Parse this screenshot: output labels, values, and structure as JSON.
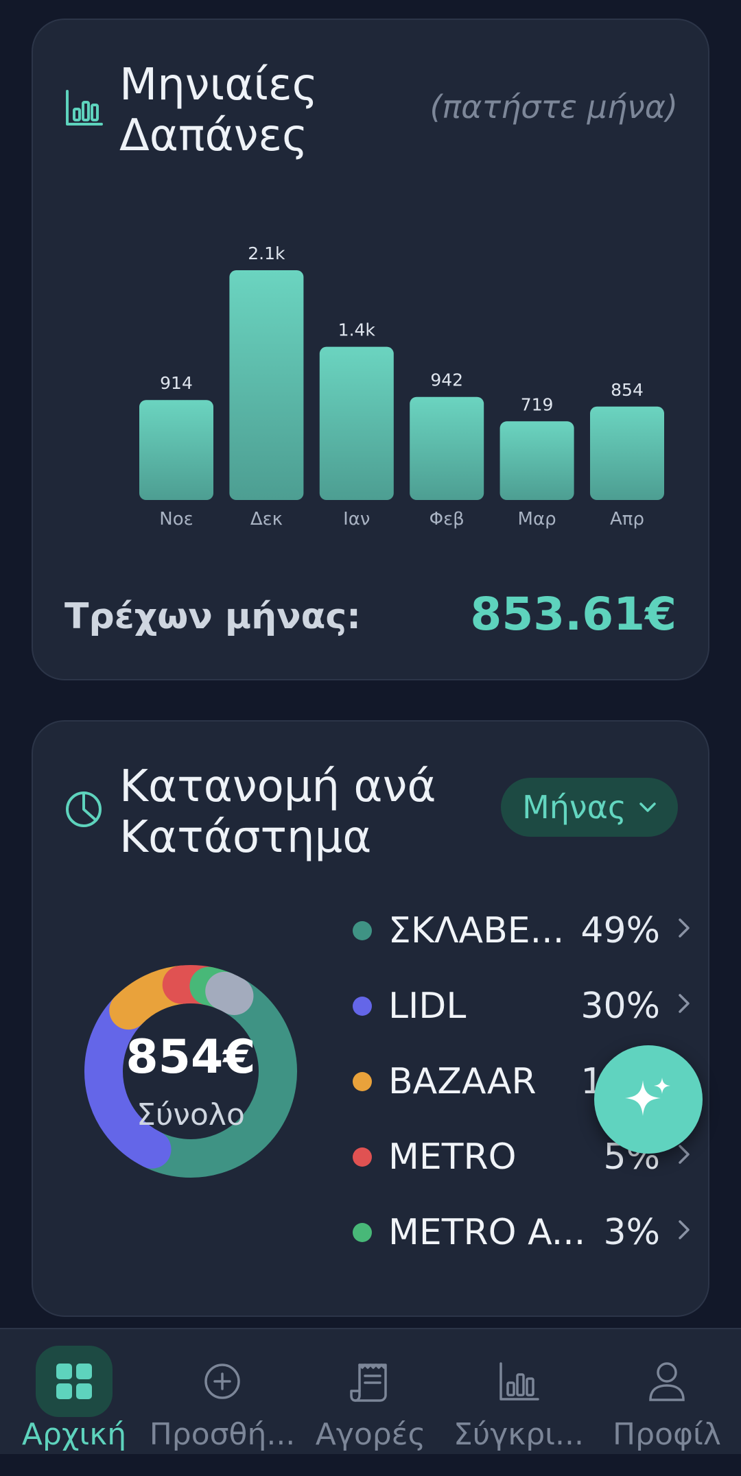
{
  "monthly": {
    "title_line1": "Μηνιαίες",
    "title_line2": "Δαπάνες",
    "hint": "(πατήστε μήνα)",
    "current_label": "Τρέχων μήνας:",
    "current_value": "853.61€"
  },
  "chart_data": {
    "type": "bar",
    "categories": [
      "Νοε",
      "Δεκ",
      "Ιαν",
      "Φεβ",
      "Μαρ",
      "Απρ"
    ],
    "values": [
      914,
      2100,
      1400,
      942,
      719,
      854
    ],
    "value_labels": [
      "914",
      "2.1k",
      "1.4k",
      "942",
      "719",
      "854"
    ],
    "title": "",
    "xlabel": "",
    "ylabel": "",
    "ylim": [
      0,
      2100
    ],
    "grid": false,
    "bar_color_top": "#6bd4c0",
    "bar_color_bottom": "#4d9e92"
  },
  "store": {
    "title_line1": "Κατανομή ανά",
    "title_line2": "Κατάστημα",
    "period_label": "Μήνας",
    "total_value": "854€",
    "total_label": "Σύνολο",
    "items": [
      {
        "name": "ΣΚΛΑΒΕ...",
        "pct": "49%",
        "color": "#3f9384"
      },
      {
        "name": "LIDL",
        "pct": "30%",
        "color": "#6466e8"
      },
      {
        "name": "BAZAAR",
        "pct": "11%",
        "color": "#e9a23b"
      },
      {
        "name": "METRO",
        "pct": "5%",
        "color": "#e05252"
      },
      {
        "name": "METRO A...",
        "pct": "3%",
        "color": "#48b878"
      }
    ],
    "other_color": "#a3abbd"
  },
  "fab": {
    "icon": "sparkle-icon"
  },
  "nav": {
    "items": [
      {
        "label": "Αρχική",
        "icon": "grid-icon",
        "active": true
      },
      {
        "label": "Προσθή...",
        "icon": "plus-circle-icon",
        "active": false
      },
      {
        "label": "Αγορές",
        "icon": "receipt-icon",
        "active": false
      },
      {
        "label": "Σύγκρι...",
        "icon": "bar-chart-icon",
        "active": false
      },
      {
        "label": "Προφίλ",
        "icon": "user-icon",
        "active": false
      }
    ]
  }
}
